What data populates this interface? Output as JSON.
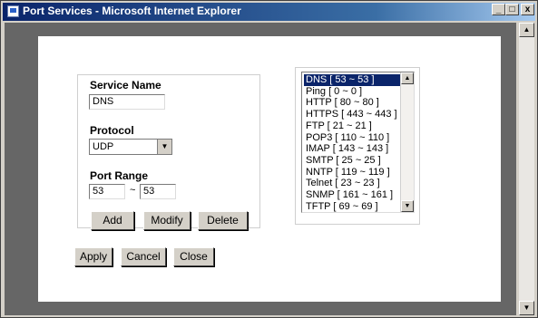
{
  "window": {
    "title": "Port Services - Microsoft Internet Explorer",
    "min_glyph": "_",
    "max_glyph": "□",
    "close_glyph": "x"
  },
  "form": {
    "service_name_label": "Service Name",
    "service_name_value": "DNS",
    "protocol_label": "Protocol",
    "protocol_value": "UDP",
    "port_range_label": "Port Range",
    "port_start": "53",
    "port_end": "53",
    "range_separator": "~"
  },
  "service_list": [
    "DNS [ 53 ~ 53 ]",
    "Ping [ 0 ~ 0 ]",
    "HTTP [ 80 ~ 80 ]",
    "HTTPS [ 443 ~ 443 ]",
    "FTP [ 21 ~ 21 ]",
    "POP3 [ 110 ~ 110 ]",
    "IMAP [ 143 ~ 143 ]",
    "SMTP [ 25 ~ 25 ]",
    "NNTP [ 119 ~ 119 ]",
    "Telnet [ 23 ~ 23 ]",
    "SNMP [ 161 ~ 161 ]",
    "TFTP [ 69 ~ 69 ]"
  ],
  "service_list_selected": 0,
  "buttons": {
    "add": "Add",
    "modify": "Modify",
    "delete": "Delete",
    "apply": "Apply",
    "cancel": "Cancel",
    "close": "Close"
  },
  "icons": {
    "scroll_up": "▲",
    "scroll_down": "▼",
    "dropdown": "▼"
  },
  "colors": {
    "title_bar": "#0a246a",
    "selection": "#0a246a",
    "dialog_face": "#d4d0c8"
  }
}
